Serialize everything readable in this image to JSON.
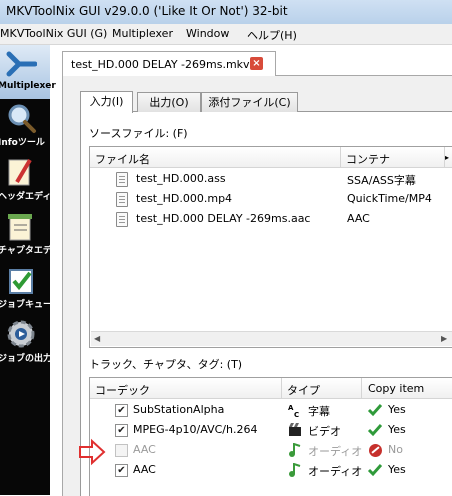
{
  "window": {
    "title": "MKVToolNix GUI v29.0.0 ('Like It Or Not') 32-bit"
  },
  "menu": [
    "MKVToolNix GUI (G)",
    "Multiplexer",
    "Window",
    "ヘルプ(H)"
  ],
  "sidebar": {
    "items": [
      {
        "label": "Multiplexer",
        "icon": "merge-icon",
        "active": true
      },
      {
        "label": "Infoツール",
        "icon": "info-tool-icon"
      },
      {
        "label": "ヘッダエディタ",
        "icon": "header-editor-icon"
      },
      {
        "label": "チャプタエディタ",
        "icon": "chapter-editor-icon"
      },
      {
        "label": "ジョブキュー",
        "icon": "job-queue-icon"
      },
      {
        "label": "ジョブの出力",
        "icon": "job-output-icon"
      }
    ]
  },
  "doc_tab": {
    "label": "test_HD.000 DELAY -269ms.mkv"
  },
  "subtabs": [
    "入力(I)",
    "出力(O)",
    "添付ファイル(C)"
  ],
  "source_files": {
    "label": "ソースファイル: (F)",
    "columns": [
      "ファイル名",
      "コンテナ"
    ],
    "rows": [
      {
        "name": "test_HD.000.ass",
        "container": "SSA/ASS字幕"
      },
      {
        "name": "test_HD.000.mp4",
        "container": "QuickTime/MP4"
      },
      {
        "name": "test_HD.000 DELAY -269ms.aac",
        "container": "AAC"
      }
    ]
  },
  "tracks": {
    "label": "トラック、チャプタ、タグ: (T)",
    "columns": [
      "コーデック",
      "タイプ",
      "Copy item"
    ],
    "rows": [
      {
        "codec": "SubStationAlpha",
        "type": "字幕",
        "type_icon": "subtitle-icon",
        "copy": "Yes",
        "checked": true,
        "enabled": true
      },
      {
        "codec": "MPEG-4p10/AVC/h.264",
        "type": "ビデオ",
        "type_icon": "video-icon",
        "copy": "Yes",
        "checked": true,
        "enabled": true
      },
      {
        "codec": "AAC",
        "type": "オーディオ",
        "type_icon": "audio-icon",
        "copy": "No",
        "checked": false,
        "enabled": false
      },
      {
        "codec": "AAC",
        "type": "オーディオ",
        "type_icon": "audio-icon",
        "copy": "Yes",
        "checked": true,
        "enabled": true
      }
    ]
  },
  "annotation": {
    "arrow_color": "#e03030"
  }
}
